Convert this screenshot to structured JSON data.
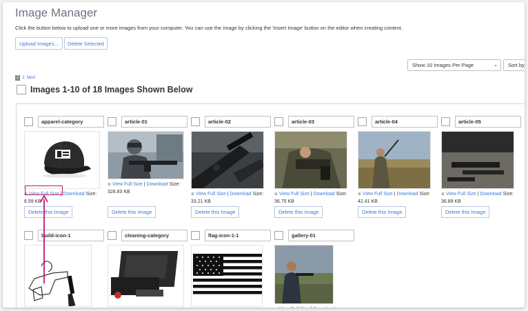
{
  "page": {
    "title": "Image Manager",
    "description": "Click the button below to upload one or more images from your computer. You can use the image by clicking the 'Insert Image' button on the editor when creating content."
  },
  "toolbar": {
    "upload_label": "Upload Images...",
    "delete_selected_label": "Delete Selected"
  },
  "controls": {
    "per_page_value": "Show 10 Images Per Page",
    "sort_value": "Sort by I"
  },
  "pagination": {
    "current": "1",
    "page2": "2",
    "next": "Next"
  },
  "section": {
    "heading": "Images 1-10 of 18 Images Shown Below"
  },
  "links": {
    "view_full": "View Full Size",
    "separator": " | ",
    "download": "Download",
    "size_label": "Size:",
    "delete": "Delete this Image"
  },
  "images": [
    {
      "name": "apparel-category",
      "size": "6.59 KB"
    },
    {
      "name": "article-01",
      "size": "328.83 KB"
    },
    {
      "name": "article-02",
      "size": "33.21 KB"
    },
    {
      "name": "article-03",
      "size": "36.75 KB"
    },
    {
      "name": "article-04",
      "size": "42.41 KB"
    },
    {
      "name": "article-05",
      "size": "36.89 KB"
    },
    {
      "name": "build-icon-1",
      "size": ""
    },
    {
      "name": "cleaning-category",
      "size": ""
    },
    {
      "name": "flag-icon-1-1",
      "size": ""
    },
    {
      "name": "gallery-01",
      "size": ""
    }
  ],
  "colors": {
    "link": "#3d7ad6",
    "highlight": "#c2186b"
  }
}
